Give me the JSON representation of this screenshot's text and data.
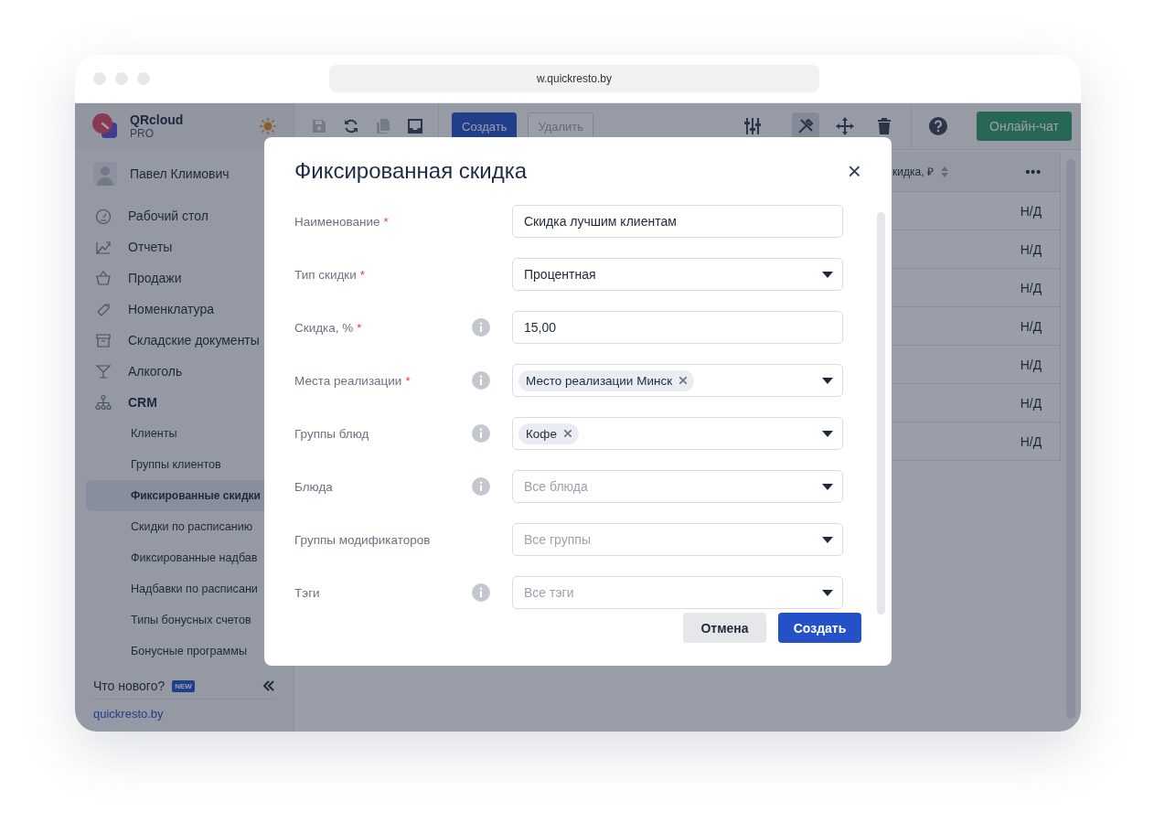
{
  "browser": {
    "url": "w.quickresto.by"
  },
  "sidebar": {
    "brand": "QRcloud",
    "plan": "PRO",
    "user": "Павел Климович",
    "items": [
      {
        "label": "Рабочий стол",
        "selected": false
      },
      {
        "label": "Отчеты",
        "selected": false
      },
      {
        "label": "Продажи",
        "selected": false
      },
      {
        "label": "Номенклатура",
        "selected": false
      },
      {
        "label": "Складские документы",
        "selected": false
      },
      {
        "label": "Алкоголь",
        "selected": false
      },
      {
        "label": "CRM",
        "selected": false,
        "expanded": true,
        "children": [
          {
            "label": "Клиенты",
            "selected": false
          },
          {
            "label": "Группы клиентов",
            "selected": false
          },
          {
            "label": "Фиксированные скидки",
            "selected": true
          },
          {
            "label": "Скидки по расписанию",
            "selected": false
          },
          {
            "label": "Фиксированные надбав",
            "selected": false
          },
          {
            "label": "Надбавки по расписани",
            "selected": false
          },
          {
            "label": "Типы бонусных счетов",
            "selected": false
          },
          {
            "label": "Бонусные программы",
            "selected": false
          }
        ]
      }
    ],
    "whats_new": "Что нового?",
    "badge": "NEW",
    "site": "quickresto.by"
  },
  "toolbar": {
    "left_icons": [
      {
        "disabled": true
      },
      {
        "disabled": false
      },
      {
        "disabled": true
      },
      {
        "disabled": false
      }
    ],
    "buttons": [
      {
        "label": "Создать",
        "kind": "primary",
        "disabled": false
      },
      {
        "label": "Удалить",
        "kind": "outline",
        "disabled": true
      }
    ],
    "right_icons": [
      {
        "selected": true
      },
      {
        "selected": false
      },
      {
        "selected": false
      },
      {
        "selected": false
      }
    ],
    "chat": "Онлайн-чат"
  },
  "table": {
    "column": "кидка, ₽",
    "menu": "•••",
    "rows": [
      "Н/Д",
      "Н/Д",
      "Н/Д",
      "Н/Д",
      "Н/Д",
      "Н/Д",
      "Н/Д"
    ]
  },
  "modal": {
    "title": "Фиксированная скидка",
    "close": "×",
    "required_mark": "*",
    "fields": [
      {
        "label": "Наименование",
        "required": true,
        "info": false,
        "kind": "text",
        "value": "Скидка лучшим клиентам"
      },
      {
        "label": "Тип скидки",
        "required": true,
        "info": false,
        "kind": "select",
        "value": "Процентная"
      },
      {
        "label": "Скидка, %",
        "required": true,
        "info": true,
        "kind": "text",
        "value": "15,00"
      },
      {
        "label": "Места реализации",
        "required": true,
        "info": true,
        "kind": "tags",
        "tags": [
          "Место реализации Минск"
        ]
      },
      {
        "label": "Группы блюд",
        "required": false,
        "info": true,
        "kind": "tags",
        "tags": [
          "Кофе"
        ]
      },
      {
        "label": "Блюда",
        "required": false,
        "info": true,
        "kind": "select",
        "placeholder": "Все блюда"
      },
      {
        "label": "Группы модификаторов",
        "required": false,
        "info": false,
        "kind": "select",
        "placeholder": "Все группы"
      },
      {
        "label": "Тэги",
        "required": false,
        "info": true,
        "kind": "select",
        "placeholder": "Все тэги"
      }
    ],
    "cancel": "Отмена",
    "submit": "Создать"
  }
}
